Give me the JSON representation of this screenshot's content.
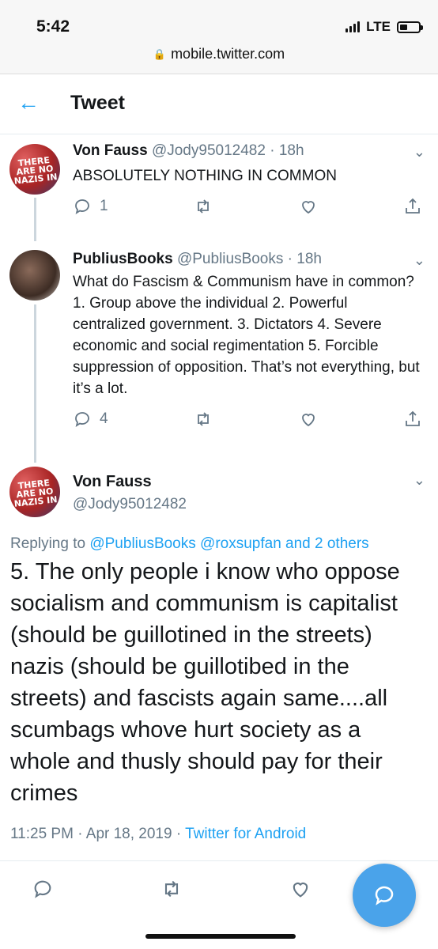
{
  "status_bar": {
    "time": "5:42",
    "network": "LTE"
  },
  "browser": {
    "url": "mobile.twitter.com"
  },
  "header": {
    "title": "Tweet"
  },
  "tweets": [
    {
      "name": "Von Fauss",
      "handle": "@Jody95012482",
      "time": "18h",
      "text": "ABSOLUTELY NOTHING IN COMMON",
      "reply_count": "1",
      "avatar_text": "THERE ARE NO NAZIS IN"
    },
    {
      "name": "PubliusBooks",
      "handle": "@PubliusBooks",
      "time": "18h",
      "text": "What do Fascism & Communism have in common? 1. Group above the individual 2. Powerful centralized government. 3. Dictators 4. Severe economic and social regimentation 5. Forcible suppression of opposition. That’s not everything, but it’s a lot.",
      "reply_count": "4"
    }
  ],
  "focus": {
    "name": "Von Fauss",
    "handle": "@Jody95012482",
    "avatar_text": "THERE ARE NO NAZIS IN",
    "replying_prefix": "Replying to",
    "replying_to": "@PubliusBooks @roxsupfan and 2 others",
    "text": "5. The only people i know who oppose socialism and communism is capitalist (should be guillotined in the streets) nazis (should be guillotibed in the streets) and fascists again same....all scumbags whove hurt society as a whole and thusly should pay for their crimes",
    "time": "11:25 PM",
    "date": "Apr 18, 2019",
    "source": "Twitter for Android"
  },
  "colors": {
    "accent": "#1da1f2",
    "muted": "#657786",
    "fab": "#4aa3ea"
  },
  "icons": [
    "back-arrow-icon",
    "lock-icon",
    "reply-icon",
    "retweet-icon",
    "like-icon",
    "share-icon",
    "chevron-down-icon",
    "compose-reply-icon"
  ]
}
